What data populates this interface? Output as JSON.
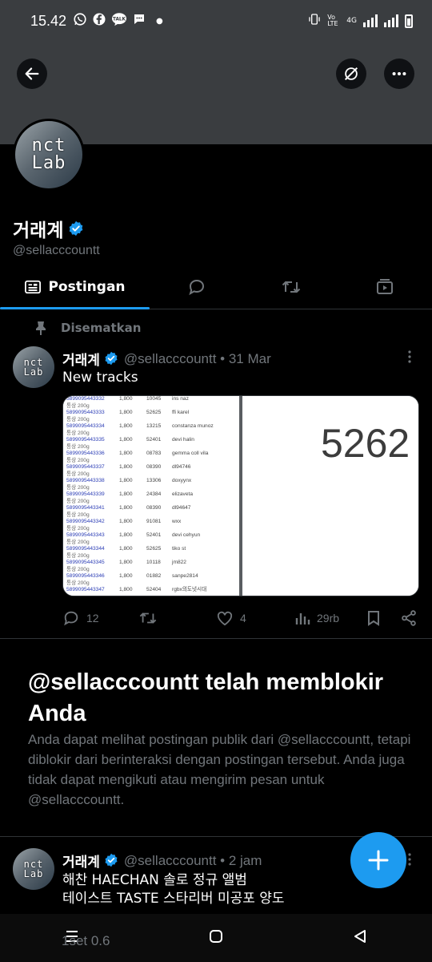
{
  "status_bar": {
    "time": "15.42",
    "network": "4G",
    "volte": "Vo LTE"
  },
  "profile": {
    "display_name": "거래계",
    "handle": "@sellacccountt",
    "avatar_text_top": "nct",
    "avatar_text_bottom": "Lab"
  },
  "tabs": [
    {
      "label": "Postingan",
      "icon": "posts-icon"
    },
    {
      "label": "",
      "icon": "replies-icon"
    },
    {
      "label": "",
      "icon": "reposts-icon"
    },
    {
      "label": "",
      "icon": "media-icon"
    }
  ],
  "pinned_label": "Disematkan",
  "pinned_tweet": {
    "name": "거래계",
    "meta": "@sellacccountt • 31 Mar",
    "text": "New tracks",
    "image_big_number": "5262",
    "image_rows": [
      {
        "id": "5899095443332",
        "qty": "1,800",
        "code": "10045",
        "user": "ins naz",
        "sub": "통상 200g"
      },
      {
        "id": "5899095443333",
        "qty": "1,800",
        "code": "52625",
        "user": "ffi karel",
        "sub": "통상 200g"
      },
      {
        "id": "5899095443334",
        "qty": "1,800",
        "code": "13215",
        "user": "constanza munoz",
        "sub": "통상 200g"
      },
      {
        "id": "5899095443335",
        "qty": "1,800",
        "code": "52401",
        "user": "devi halin",
        "sub": "통상 200g"
      },
      {
        "id": "5899095443336",
        "qty": "1,800",
        "code": "08783",
        "user": "gemma coll vila",
        "sub": "통상 200g"
      },
      {
        "id": "5899095443337",
        "qty": "1,800",
        "code": "08390",
        "user": "dl94746",
        "sub": "통상 200g"
      },
      {
        "id": "5899095443338",
        "qty": "1,800",
        "code": "13306",
        "user": "doxyynx",
        "sub": "통상 200g"
      },
      {
        "id": "5899095443339",
        "qty": "1,800",
        "code": "24384",
        "user": "elizaveta",
        "sub": "통상 200g"
      },
      {
        "id": "5899095443341",
        "qty": "1,800",
        "code": "08390",
        "user": "dl94647",
        "sub": "통상 200g"
      },
      {
        "id": "5899095443342",
        "qty": "1,800",
        "code": "91081",
        "user": "wxx",
        "sub": "통상 200g"
      },
      {
        "id": "5899095443343",
        "qty": "1,800",
        "code": "52401",
        "user": "devi cehyun",
        "sub": "통상 200g"
      },
      {
        "id": "5899095443344",
        "qty": "1,800",
        "code": "52625",
        "user": "tiko st",
        "sub": "통상 200g"
      },
      {
        "id": "5899095443345",
        "qty": "1,800",
        "code": "10118",
        "user": "jm822",
        "sub": "통상 200g"
      },
      {
        "id": "5899095443346",
        "qty": "1,800",
        "code": "01882",
        "user": "sanpe2814",
        "sub": "통상 200g"
      },
      {
        "id": "5899095443347",
        "qty": "1,800",
        "code": "52404",
        "user": "rgbx의도넛시대",
        "sub": ""
      }
    ],
    "replies": "12",
    "reposts": "",
    "likes": "4",
    "views": "29rb"
  },
  "blocked": {
    "title": "@sellacccountt telah memblokir Anda",
    "body": "Anda dapat melihat postingan publik dari @sellacccountt, tetapi diblokir dari berinteraksi dengan postingan tersebut. Anda juga tidak dapat mengikuti atau mengirim pesan untuk @sellacccountt."
  },
  "second_tweet": {
    "name": "거래계",
    "meta": "@sellacccountt • 2 jam",
    "line1": "해찬 HAECHAN 솔로 정규 앨범",
    "line2": "테이스트 TASTE  스타리버 미공포 양도",
    "peek": "1set 0.6"
  },
  "colors": {
    "accent": "#1d9bf0",
    "background": "#000000",
    "muted": "#71767b",
    "banner": "#3a3d40"
  }
}
